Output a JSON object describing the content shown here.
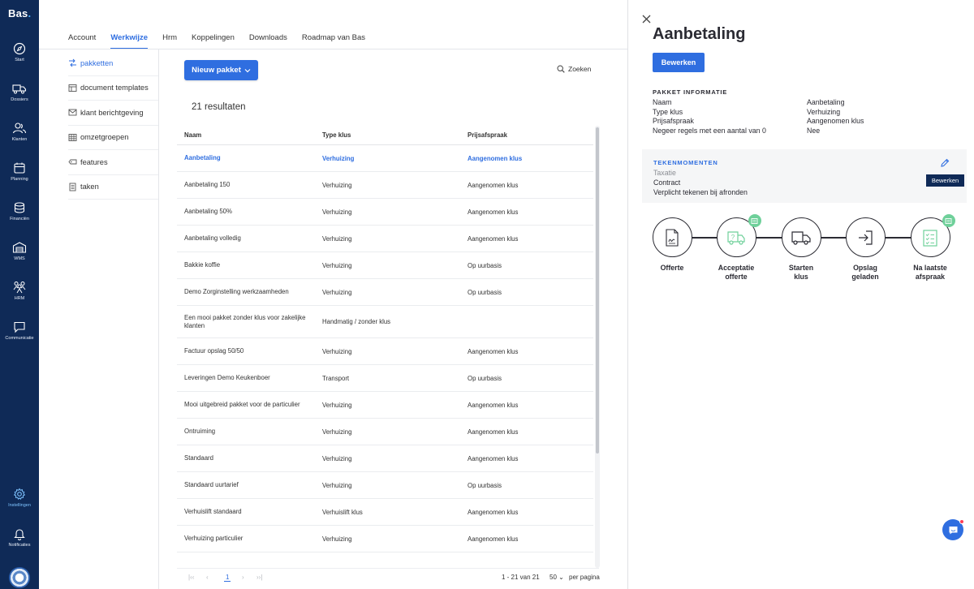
{
  "app": {
    "logo": "Bas",
    "logo_dot": "."
  },
  "nav": {
    "items": [
      {
        "label": "Start",
        "icon": "compass-icon"
      },
      {
        "label": "Dossiers",
        "icon": "truck-icon"
      },
      {
        "label": "Klanten",
        "icon": "people-icon"
      },
      {
        "label": "Planning",
        "icon": "calendar-icon"
      },
      {
        "label": "Financiën",
        "icon": "coins-icon"
      },
      {
        "label": "WMS",
        "icon": "warehouse-icon"
      },
      {
        "label": "HRM",
        "icon": "team-icon"
      },
      {
        "label": "Communicatie",
        "icon": "chat-icon"
      },
      {
        "label": "Instellingen",
        "icon": "gear-icon"
      },
      {
        "label": "Notificaties",
        "icon": "bell-icon"
      }
    ],
    "active": "Instellingen"
  },
  "tabs": [
    "Account",
    "Werkwijze",
    "Hrm",
    "Koppelingen",
    "Downloads",
    "Roadmap van Bas"
  ],
  "active_tab": "Werkwijze",
  "subnav": [
    "pakketten",
    "document templates",
    "klant berichtgeving",
    "omzetgroepen",
    "features",
    "taken"
  ],
  "toolbar": {
    "new_label": "Nieuw pakket",
    "search_label": "Zoeken"
  },
  "results_label": "21 resultaten",
  "table": {
    "headers": [
      "Naam",
      "Type klus",
      "Prijsafspraak"
    ],
    "rows": [
      [
        "Aanbetaling",
        "Verhuizing",
        "Aangenomen klus"
      ],
      [
        "Aanbetaling 150",
        "Verhuizing",
        "Aangenomen klus"
      ],
      [
        "Aanbetaling 50%",
        "Verhuizing",
        "Aangenomen klus"
      ],
      [
        "Aanbetaling volledig",
        "Verhuizing",
        "Aangenomen klus"
      ],
      [
        "Bakkie koffie",
        "Verhuizing",
        "Op uurbasis"
      ],
      [
        "Demo Zorginstelling werkzaamheden",
        "Verhuizing",
        "Op uurbasis"
      ],
      [
        "Een mooi pakket zonder klus voor zakelijke klanten",
        "Handmatig / zonder klus",
        ""
      ],
      [
        "Factuur opslag 50/50",
        "Verhuizing",
        "Aangenomen klus"
      ],
      [
        "Leveringen Demo Keukenboer",
        "Transport",
        "Op uurbasis"
      ],
      [
        "Mooi uitgebreid pakket voor de particulier",
        "Verhuizing",
        "Aangenomen klus"
      ],
      [
        "Ontruiming",
        "Verhuizing",
        "Aangenomen klus"
      ],
      [
        "Standaard",
        "Verhuizing",
        "Aangenomen klus"
      ],
      [
        "Standaard uurtarief",
        "Verhuizing",
        "Op uurbasis"
      ],
      [
        "Verhuislift standaard",
        "Verhuislift klus",
        "Aangenomen klus"
      ],
      [
        "Verhuizing particulier",
        "Verhuizing",
        "Aangenomen klus"
      ]
    ]
  },
  "pager": {
    "current": "1",
    "range": "1 - 21 van 21",
    "per_page": "50",
    "per_page_label": "per pagina"
  },
  "panel": {
    "title": "Aanbetaling",
    "edit_label": "Bewerken",
    "info_title": "PAKKET INFORMATIE",
    "info": [
      [
        "Naam",
        "Aanbetaling"
      ],
      [
        "Type klus",
        "Verhuizing"
      ],
      [
        "Prijsafspraak",
        "Aangenomen klus"
      ],
      [
        "Negeer regels met een aantal van 0",
        "Nee"
      ]
    ],
    "tek_title": "TEKENMOMENTEN",
    "tek_lines": [
      "Taxatie",
      "Contract",
      "Verplicht tekenen bij afronden"
    ],
    "tooltip": "Bewerken",
    "steps": [
      {
        "l1": "Offerte",
        "l2": "",
        "icon": "document-icon",
        "badge": false
      },
      {
        "l1": "Acceptatie",
        "l2": "offerte",
        "icon": "truck-check-icon",
        "badge": true
      },
      {
        "l1": "Starten",
        "l2": "klus",
        "icon": "truck-icon",
        "badge": false
      },
      {
        "l1": "Opslag",
        "l2": "geladen",
        "icon": "enter-icon",
        "badge": false
      },
      {
        "l1": "Na laatste",
        "l2": "afspraak",
        "icon": "checklist-icon",
        "badge": true
      }
    ]
  },
  "colors": {
    "nav_bg": "#0f2a57",
    "accent": "#2f6ee0",
    "badge": "#6fd09a",
    "notify": "#ff3d57"
  }
}
